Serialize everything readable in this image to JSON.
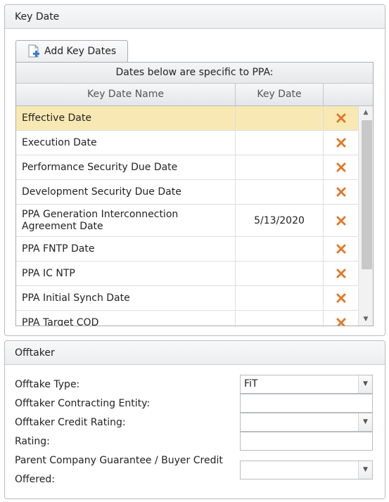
{
  "key_dates": {
    "section_title": "Key Date",
    "add_button_label": "Add Key Dates",
    "grid_caption": "Dates below are specific to PPA:",
    "columns": [
      "Key Date Name",
      "Key Date",
      ""
    ],
    "rows": [
      {
        "name": "Effective Date",
        "date": ""
      },
      {
        "name": "Execution Date",
        "date": ""
      },
      {
        "name": "Performance Security Due Date",
        "date": ""
      },
      {
        "name": "Development Security Due Date",
        "date": ""
      },
      {
        "name": "PPA Generation Interconnection Agreement Date",
        "date": "5/13/2020"
      },
      {
        "name": "PPA FNTP Date",
        "date": ""
      },
      {
        "name": "PPA IC NTP",
        "date": ""
      },
      {
        "name": "PPA Initial Synch Date",
        "date": ""
      },
      {
        "name": "PPA Target COD",
        "date": ""
      }
    ],
    "delete_icon_color": "#e07a2a",
    "selected_row_color": "#f8e9b4"
  },
  "offtaker": {
    "section_title": "Offtaker",
    "fields": {
      "offtake_type": {
        "label": "Offtake Type:",
        "value": "FiT"
      },
      "contracting_entity": {
        "label": "Offtaker Contracting Entity:",
        "value": ""
      },
      "credit_rating": {
        "label": "Offtaker Credit Rating:",
        "value": ""
      },
      "rating": {
        "label": "Rating:",
        "value": ""
      },
      "parent_guarantee": {
        "label_line1": "Parent Company Guarantee / Buyer Credit",
        "label_line2": "Offered:",
        "value": ""
      }
    }
  }
}
